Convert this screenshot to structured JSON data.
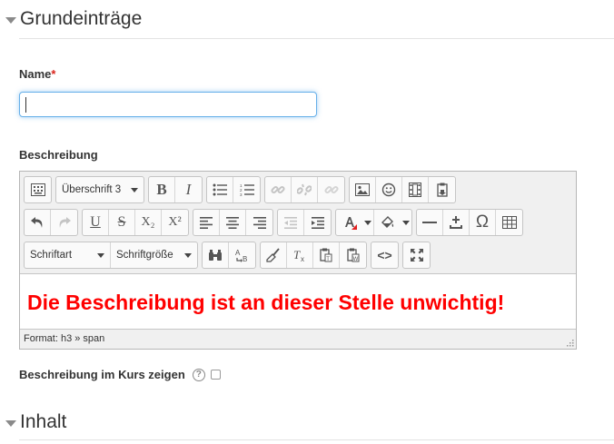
{
  "sections": {
    "general": "Grundeinträge",
    "content": "Inhalt"
  },
  "name_field": {
    "label": "Name",
    "required_marker": "*",
    "value": ""
  },
  "description": {
    "label": "Beschreibung",
    "format_select": "Überschrift 3",
    "font_select": "Schriftart",
    "size_select": "Schriftgröße",
    "bold_label": "B",
    "italic_label": "I",
    "underline_label": "U",
    "strike_label": "S",
    "subscript_label": "X₂",
    "superscript_label": "X²",
    "omega_label": "Ω",
    "code_label": "<>",
    "content_text": "Die Beschreibung ist an dieser Stelle unwichtig!",
    "content_color": "#ff0000",
    "status": "Format: h3 » span"
  },
  "show_in_course": {
    "label": "Beschreibung im Kurs zeigen",
    "help": "?",
    "checked": false
  },
  "colors": {
    "focus_border": "#66afe9",
    "required": "#d9241c"
  }
}
